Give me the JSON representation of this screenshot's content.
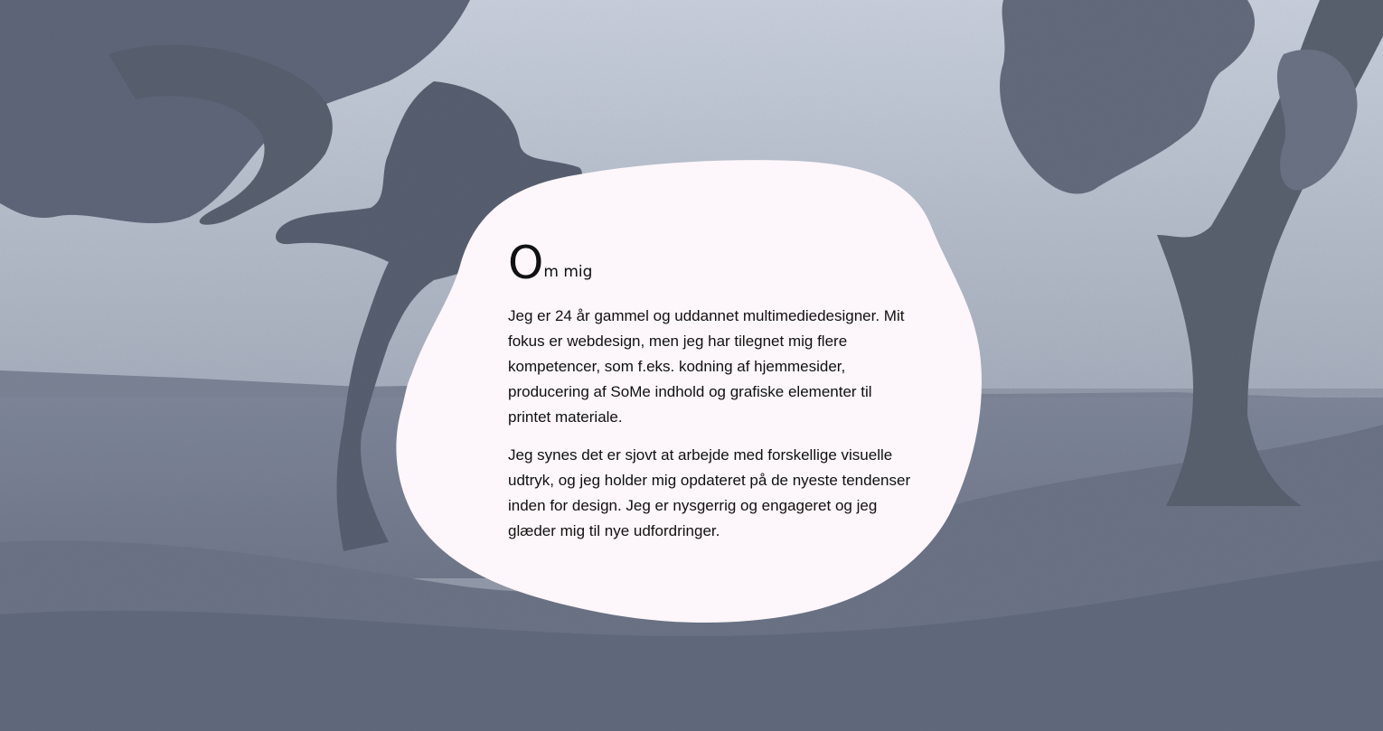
{
  "section": {
    "heading_initial": "O",
    "heading_rest": "m mig",
    "paragraphs": [
      "Jeg er 24 år gammel og uddannet multimediedesigner. Mit fokus er webdesign, men jeg har tilegnet mig flere kompetencer, som f.eks. kodning af hjemmesider, producering af SoMe indhold og grafiske elementer til printet materiale.",
      "Jeg synes det er sjovt at arbejde med forskellige visuelle udtryk, og jeg holder mig opdateret på de nyeste tendenser inden for design. Jeg er nysgerrig og engageret og jeg glæder mig til nye udfordringer."
    ]
  },
  "colors": {
    "blob": "#fdf6fa",
    "photo_tint": "#8b93a4"
  }
}
